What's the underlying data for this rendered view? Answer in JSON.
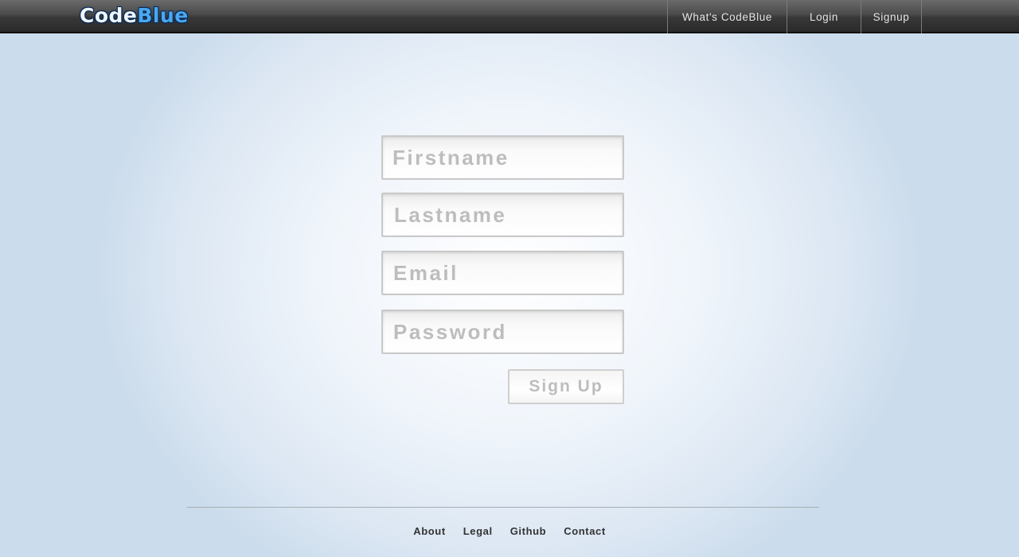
{
  "header": {
    "logo": {
      "part_a": "Code",
      "part_b": "Blue"
    },
    "nav": [
      {
        "label": "What's CodeBlue"
      },
      {
        "label": "Login"
      },
      {
        "label": "Signup"
      }
    ]
  },
  "form": {
    "firstname_placeholder": "Firstname",
    "lastname_placeholder": "Lastname",
    "email_placeholder": "Email",
    "password_placeholder": "Password",
    "submit_label": "Sign Up"
  },
  "footer": {
    "links": [
      {
        "label": "About"
      },
      {
        "label": "Legal"
      },
      {
        "label": "Github"
      },
      {
        "label": "Contact"
      }
    ]
  },
  "colors": {
    "topbar": "#3a3a3a",
    "logo_light": "#eef6ff",
    "logo_accent": "#4aa7f0",
    "placeholder": "#bdbdbd",
    "background": "#dce7f3"
  }
}
